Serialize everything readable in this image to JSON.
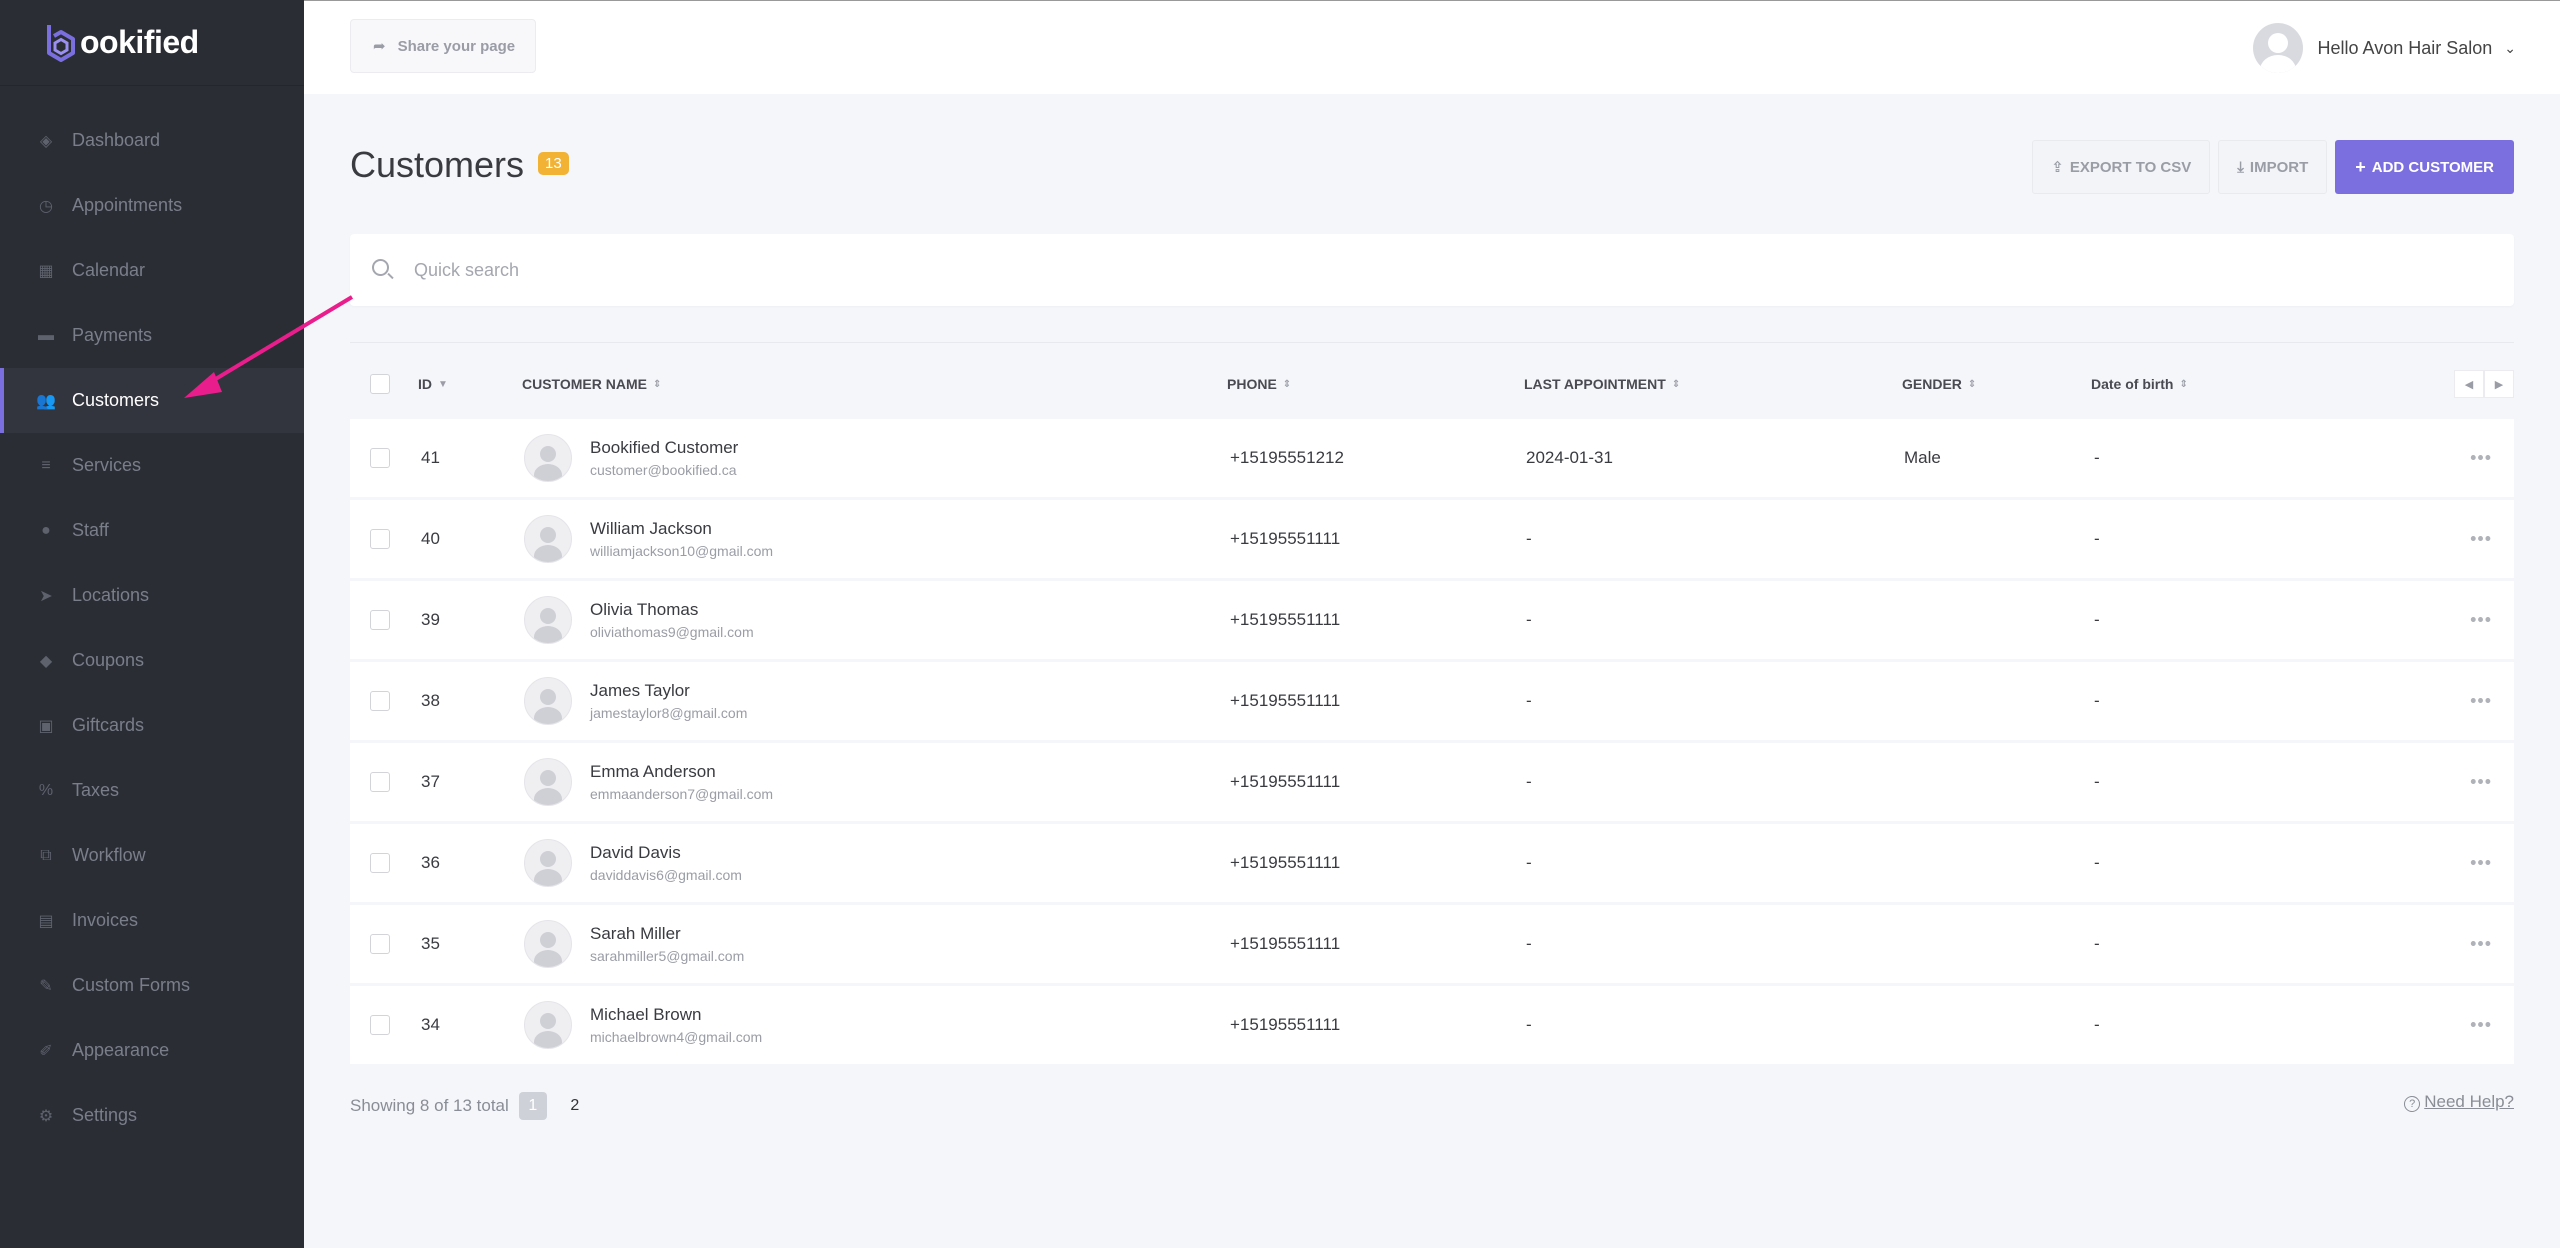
{
  "brand": {
    "logo_text": "ookified",
    "logo_letter": "b",
    "accent": "#7b6fe0"
  },
  "sidebar": {
    "items": [
      {
        "label": "Dashboard",
        "icon": "dashboard-icon"
      },
      {
        "label": "Appointments",
        "icon": "clock-icon"
      },
      {
        "label": "Calendar",
        "icon": "calendar-icon"
      },
      {
        "label": "Payments",
        "icon": "wallet-icon"
      },
      {
        "label": "Customers",
        "icon": "users-icon",
        "active": true
      },
      {
        "label": "Services",
        "icon": "list-icon"
      },
      {
        "label": "Staff",
        "icon": "user-icon"
      },
      {
        "label": "Locations",
        "icon": "location-arrow-icon"
      },
      {
        "label": "Coupons",
        "icon": "tag-icon"
      },
      {
        "label": "Giftcards",
        "icon": "gift-icon"
      },
      {
        "label": "Taxes",
        "icon": "percent-icon"
      },
      {
        "label": "Workflow",
        "icon": "workflow-icon"
      },
      {
        "label": "Invoices",
        "icon": "file-icon"
      },
      {
        "label": "Custom Forms",
        "icon": "magic-icon"
      },
      {
        "label": "Appearance",
        "icon": "brush-icon"
      },
      {
        "label": "Settings",
        "icon": "gear-icon"
      }
    ]
  },
  "topbar": {
    "share_label": "Share your page",
    "user_greeting": "Hello Avon Hair Salon"
  },
  "page": {
    "title": "Customers",
    "count": "13",
    "export_label": "EXPORT TO CSV",
    "import_label": "IMPORT",
    "add_label": "ADD CUSTOMER"
  },
  "search": {
    "placeholder": "Quick search"
  },
  "table": {
    "headers": {
      "id": "ID",
      "name": "CUSTOMER NAME",
      "phone": "PHONE",
      "last_appointment": "LAST APPOINTMENT",
      "gender": "GENDER",
      "dob": "Date of birth"
    },
    "rows": [
      {
        "id": "41",
        "name": "Bookified Customer",
        "email": "customer@bookified.ca",
        "phone": "+15195551212",
        "last": "2024-01-31",
        "gender": "Male",
        "dob": "-"
      },
      {
        "id": "40",
        "name": "William Jackson",
        "email": "williamjackson10@gmail.com",
        "phone": "+15195551111",
        "last": "-",
        "gender": "",
        "dob": "-"
      },
      {
        "id": "39",
        "name": "Olivia Thomas",
        "email": "oliviathomas9@gmail.com",
        "phone": "+15195551111",
        "last": "-",
        "gender": "",
        "dob": "-"
      },
      {
        "id": "38",
        "name": "James Taylor",
        "email": "jamestaylor8@gmail.com",
        "phone": "+15195551111",
        "last": "-",
        "gender": "",
        "dob": "-"
      },
      {
        "id": "37",
        "name": "Emma Anderson",
        "email": "emmaanderson7@gmail.com",
        "phone": "+15195551111",
        "last": "-",
        "gender": "",
        "dob": "-"
      },
      {
        "id": "36",
        "name": "David Davis",
        "email": "daviddavis6@gmail.com",
        "phone": "+15195551111",
        "last": "-",
        "gender": "",
        "dob": "-"
      },
      {
        "id": "35",
        "name": "Sarah Miller",
        "email": "sarahmiller5@gmail.com",
        "phone": "+15195551111",
        "last": "-",
        "gender": "",
        "dob": "-"
      },
      {
        "id": "34",
        "name": "Michael Brown",
        "email": "michaelbrown4@gmail.com",
        "phone": "+15195551111",
        "last": "-",
        "gender": "",
        "dob": "-"
      }
    ]
  },
  "footer": {
    "showing": "Showing 8 of 13 total",
    "page_current": "1",
    "page_next": "2",
    "help": "Need Help?"
  },
  "annotation": {
    "color": "#e91e8c"
  }
}
